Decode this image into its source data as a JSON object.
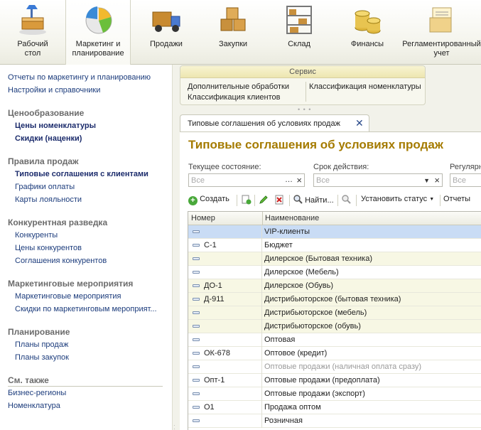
{
  "sections": [
    {
      "label": "Рабочий\nстол",
      "icon": "desk-icon",
      "active": false
    },
    {
      "label": "Маркетинг и\nпланирование",
      "icon": "pie-chart-icon",
      "active": true
    },
    {
      "label": "Продажи",
      "icon": "truck-icon",
      "active": false
    },
    {
      "label": "Закупки",
      "icon": "boxes-icon",
      "active": false
    },
    {
      "label": "Склад",
      "icon": "warehouse-shelves-icon",
      "active": false
    },
    {
      "label": "Финансы",
      "icon": "coins-icon",
      "active": false
    },
    {
      "label": "Регламентированный\nучет",
      "icon": "documents-icon",
      "active": false
    }
  ],
  "nav": {
    "top_links": [
      "Отчеты по маркетингу и планированию",
      "Настройки и справочники"
    ],
    "groups": [
      {
        "title": "Ценообразование",
        "items": [
          {
            "label": "Цены номенклатуры",
            "bold": true
          },
          {
            "label": "Скидки (наценки)",
            "bold": true
          }
        ]
      },
      {
        "title": "Правила продаж",
        "items": [
          {
            "label": "Типовые соглашения с клиентами",
            "bold": true
          },
          {
            "label": "Графики оплаты",
            "bold": false
          },
          {
            "label": "Карты лояльности",
            "bold": false
          }
        ]
      },
      {
        "title": "Конкурентная разведка",
        "items": [
          {
            "label": "Конкуренты",
            "bold": false
          },
          {
            "label": "Цены конкурентов",
            "bold": false
          },
          {
            "label": "Соглашения конкурентов",
            "bold": false
          }
        ]
      },
      {
        "title": "Маркетинговые мероприятия",
        "items": [
          {
            "label": "Маркетинговые мероприятия",
            "bold": false
          },
          {
            "label": "Скидки по маркетинговым мероприят...",
            "bold": false
          }
        ]
      },
      {
        "title": "Планирование",
        "items": [
          {
            "label": "Планы продаж",
            "bold": false
          },
          {
            "label": "Планы закупок",
            "bold": false
          }
        ]
      }
    ],
    "see_also_title": "См. также",
    "see_also": [
      "Бизнес-регионы",
      "Номенклатура"
    ]
  },
  "service": {
    "title": "Сервис",
    "col1": [
      "Дополнительные обработки",
      "Классификация клиентов"
    ],
    "col2": [
      "Классификация номенклатуры"
    ]
  },
  "tab": {
    "label": "Типовые соглашения об условиях продаж",
    "close": "✕"
  },
  "form": {
    "title": "Типовые соглашения об условиях продаж",
    "filters": [
      {
        "label": "Текущее состояние:",
        "placeholder": "Все"
      },
      {
        "label": "Срок действия:",
        "placeholder": "Все"
      },
      {
        "label": "Регулярн",
        "placeholder": "Все"
      }
    ],
    "toolbar": {
      "create": "Создать",
      "find": "Найти...",
      "set_status": "Установить статус",
      "reports": "Отчеты"
    },
    "columns": [
      "Номер",
      "Наименование"
    ],
    "rows": [
      {
        "number": "",
        "name": "VIP-клиенты",
        "style": "sel"
      },
      {
        "number": "С-1",
        "name": "Бюджет",
        "style": ""
      },
      {
        "number": "",
        "name": "Дилерское (Бытовая техника)",
        "style": "alt"
      },
      {
        "number": "",
        "name": "Дилерское (Мебель)",
        "style": ""
      },
      {
        "number": "ДО-1",
        "name": "Дилерское (Обувь)",
        "style": "alt"
      },
      {
        "number": "Д-911",
        "name": "Дистрибьюторское (бытовая техника)",
        "style": "alt"
      },
      {
        "number": "",
        "name": "Дистрибьюторское (мебель)",
        "style": "alt"
      },
      {
        "number": "",
        "name": "Дистрибьюторское (обувь)",
        "style": "alt"
      },
      {
        "number": "",
        "name": "Оптовая",
        "style": ""
      },
      {
        "number": "ОК-678",
        "name": "Оптовое (кредит)",
        "style": ""
      },
      {
        "number": "",
        "name": "Оптовые продажи (наличная оплата сразу)",
        "style": "grey"
      },
      {
        "number": "Опт-1",
        "name": "Оптовые продажи (предоплата)",
        "style": ""
      },
      {
        "number": "",
        "name": "Оптовые продажи (экспорт)",
        "style": ""
      },
      {
        "number": "О1",
        "name": "Продажа оптом",
        "style": ""
      },
      {
        "number": "",
        "name": "Розничная",
        "style": ""
      }
    ]
  },
  "colors": {
    "title": "#a57b00",
    "link": "#1c3c7c",
    "selected_row": "#c9dcf5",
    "alt_row": "#f7f7e4"
  }
}
